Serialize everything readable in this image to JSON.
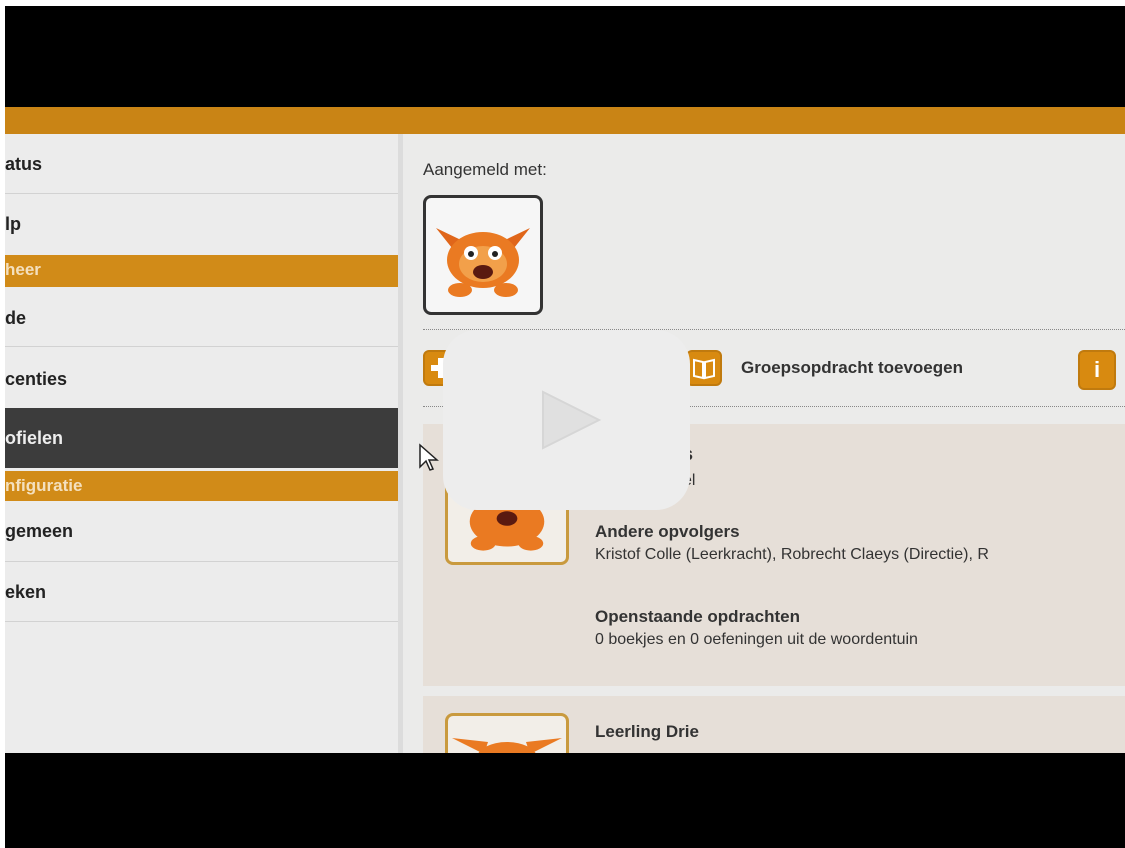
{
  "sidebar": {
    "items": [
      {
        "label": "atus"
      },
      {
        "label": "lp"
      },
      {
        "label": "heer",
        "kind": "section-header"
      },
      {
        "label": "de"
      },
      {
        "label": "centies"
      },
      {
        "label": "ofielen",
        "kind": "active"
      },
      {
        "label": "nfiguratie",
        "kind": "section-header"
      },
      {
        "label": "gemeen"
      },
      {
        "label": "eken"
      }
    ]
  },
  "main": {
    "logged_in_label": "Aangemeld met:",
    "group_task_label": "Groepsopdracht toevoegen",
    "info_icon": "i",
    "card1": {
      "name_fragment": "ys",
      "sub_fragment": "el",
      "followers_heading": "Andere opvolgers",
      "followers_text": "Kristof Colle (Leerkracht), Robrecht Claeys (Directie), R",
      "open_tasks_heading": "Openstaande opdrachten",
      "open_tasks_text": "0 boekjes en 0 oefeningen uit de woordentuin"
    },
    "card2": {
      "name": "Leerling Drie"
    }
  },
  "colors": {
    "accent_orange": "#d18b18",
    "active_dark": "#3c3c3c",
    "letterbox": "#000000"
  },
  "icons": [
    "monster-avatar-icon",
    "plus-icon",
    "book-icon",
    "info-icon",
    "play-icon",
    "mouse-cursor-icon"
  ]
}
